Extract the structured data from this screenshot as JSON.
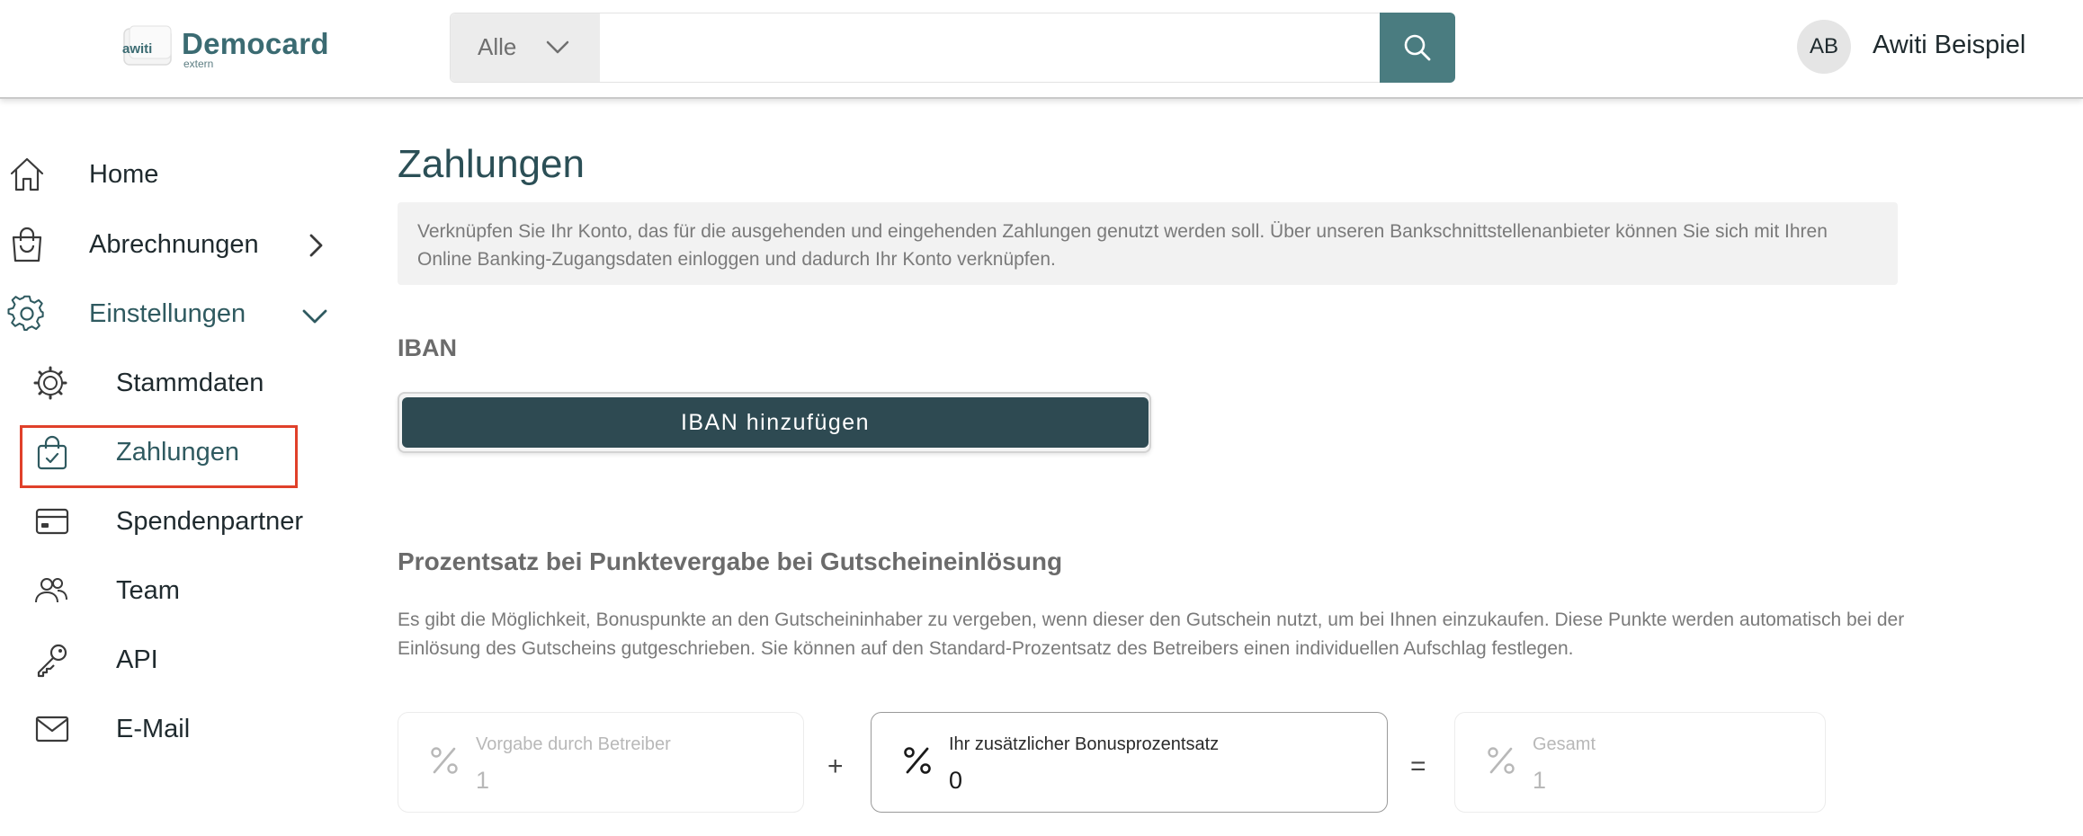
{
  "header": {
    "logo": {
      "badge_text": "awiti",
      "title": "Democard",
      "subtitle": "extern"
    },
    "search": {
      "scope_selected": "Alle",
      "placeholder": "",
      "value": ""
    },
    "user": {
      "initials": "AB",
      "name": "Awiti Beispiel"
    }
  },
  "sidebar": {
    "items": [
      {
        "label": "Home",
        "icon": "home-icon"
      },
      {
        "label": "Abrechnungen",
        "icon": "shopping-bag-icon"
      },
      {
        "label": "Einstellungen",
        "icon": "gear-icon",
        "expanded": true
      },
      {
        "label": "Stammdaten",
        "icon": "cog-wheel-icon"
      },
      {
        "label": "Zahlungen",
        "icon": "bag-check-icon",
        "selected": true
      },
      {
        "label": "Spendenpartner",
        "icon": "credit-card-icon"
      },
      {
        "label": "Team",
        "icon": "people-icon"
      },
      {
        "label": "API",
        "icon": "key-icon"
      },
      {
        "label": "E-Mail",
        "icon": "mail-icon"
      }
    ]
  },
  "main": {
    "title": "Zahlungen",
    "info": "Verknüpfen Sie Ihr Konto, das für die ausgehenden und eingehenden Zahlungen genutzt werden soll. Über unseren Bankschnittstellenanbieter können Sie sich mit Ihren Online Banking-Zugangsdaten einloggen und dadurch Ihr Konto verknüpfen.",
    "iban": {
      "heading": "IBAN",
      "button_label": "IBAN hinzufügen"
    },
    "percentage": {
      "heading": "Prozentsatz bei Punktevergabe bei Gutscheineinlösung",
      "description": "Es gibt die Möglichkeit, Bonuspunkte an den Gutscheininhaber zu vergeben, wenn dieser den Gutschein nutzt, um bei Ihnen einzukaufen. Diese Punkte werden automatisch bei der Einlösung des Gutscheins gutgeschrieben. Sie können auf den Standard-Prozentsatz des Betreibers einen individuellen Aufschlag festlegen.",
      "fields": [
        {
          "label": "Vorgabe durch Betreiber",
          "value": "1",
          "editable": false
        },
        {
          "label": "Ihr zusätzlicher Bonusprozentsatz",
          "value": "0",
          "editable": true
        },
        {
          "label": "Gesamt",
          "value": "1",
          "editable": false
        }
      ],
      "operators": {
        "plus": "+",
        "equals": "="
      }
    }
  },
  "colors": {
    "brand_teal": "#4a7c80",
    "primary_button": "#2e4a52",
    "title": "#2b4f56",
    "highlight": "#e0402a"
  }
}
